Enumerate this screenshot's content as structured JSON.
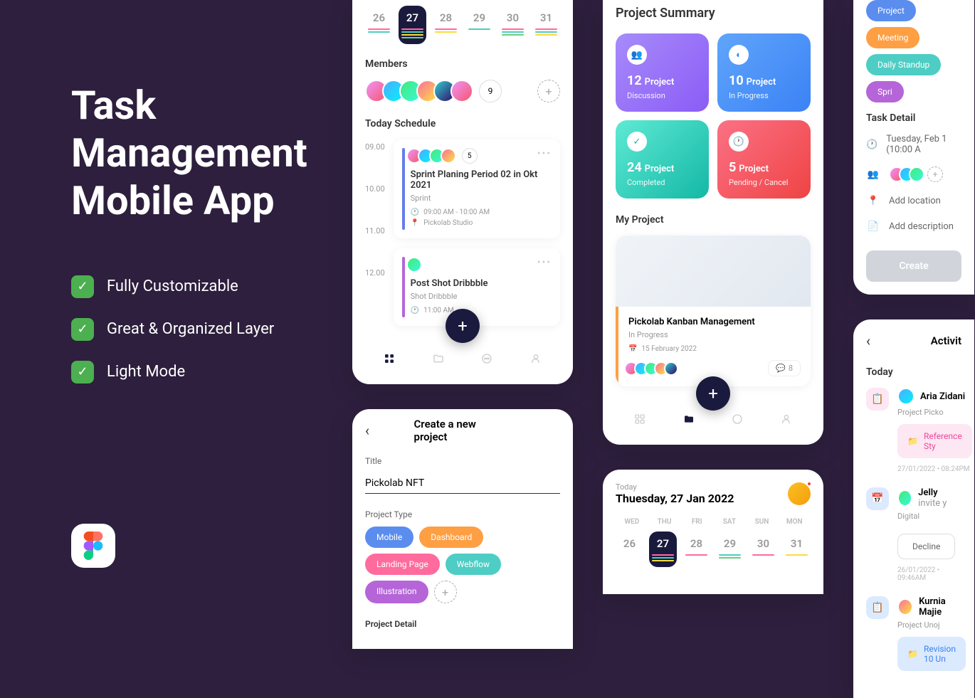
{
  "hero": {
    "title": "Task\nManagement\nMobile App",
    "features": [
      "Fully Customizable",
      "Great & Organized Layer",
      "Light Mode"
    ]
  },
  "schedule": {
    "days": [
      {
        "num": "26"
      },
      {
        "num": "27",
        "active": true
      },
      {
        "num": "28"
      },
      {
        "num": "29"
      },
      {
        "num": "30"
      },
      {
        "num": "31"
      }
    ],
    "members_title": "Members",
    "member_count": "9",
    "today_title": "Today Schedule",
    "times": [
      "09.00",
      "10.00",
      "11.00",
      "12.00"
    ],
    "events": [
      {
        "title": "Sprint Planing Period 02 in Okt 2021",
        "subtitle": "Sprint",
        "time": "09:00 AM - 10:00 AM",
        "location": "Pickolab Studio",
        "avcount": "5"
      },
      {
        "title": "Post Shot Dribbble",
        "subtitle": "Shot Dribbble",
        "time": "11:00 AM"
      }
    ]
  },
  "createProject": {
    "header": "Create a new project",
    "title_label": "Title",
    "title_value": "Pickolab NFT",
    "type_label": "Project Type",
    "types": [
      "Mobile",
      "Dashboard",
      "Landing Page",
      "Webflow",
      "Illustration"
    ],
    "detail_label": "Project Detail"
  },
  "summary": {
    "title": "Project Summary",
    "cards": [
      {
        "num": "12",
        "label": "Project",
        "sub": "Discussion"
      },
      {
        "num": "10",
        "label": "Project",
        "sub": "In Progress"
      },
      {
        "num": "24",
        "label": "Project",
        "sub": "Completed"
      },
      {
        "num": "5",
        "label": "Project",
        "sub": "Pending / Cancel"
      }
    ],
    "myproject_title": "My Project",
    "project": {
      "title": "Pickolab Kanban Management",
      "status": "In Progress",
      "date": "15 February 2022",
      "comments": "8"
    }
  },
  "today": {
    "label": "Today",
    "date": "Thuesday, 27 Jan 2022",
    "wdays": [
      "WED",
      "THU",
      "FRI",
      "SAT",
      "SUN",
      "MON"
    ],
    "nums": [
      "26",
      "27",
      "28",
      "29",
      "30",
      "31"
    ]
  },
  "taskDetail": {
    "chips": [
      "Project",
      "Meeting",
      "Daily Standup",
      "Spri"
    ],
    "title": "Task Detail",
    "time": "Tuesday, Feb 1 (10:00 A",
    "location": "Add location",
    "description": "Add description",
    "button": "Create"
  },
  "activity": {
    "header": "Activit",
    "today": "Today",
    "items": [
      {
        "name": "Aria Zidani",
        "sub": "Project Picko",
        "attach": "Reference Sty",
        "meta": "27/01/2022  •  08:24PM"
      },
      {
        "name": "Jelly",
        "invite": "invite y",
        "sub": "Digital",
        "decline": "Decline",
        "meta": "26/01/2022  •  09:46AM"
      },
      {
        "name": "Kurnia Majie",
        "sub": "Project Unoj",
        "attach": "Revision 10 Un"
      }
    ]
  }
}
